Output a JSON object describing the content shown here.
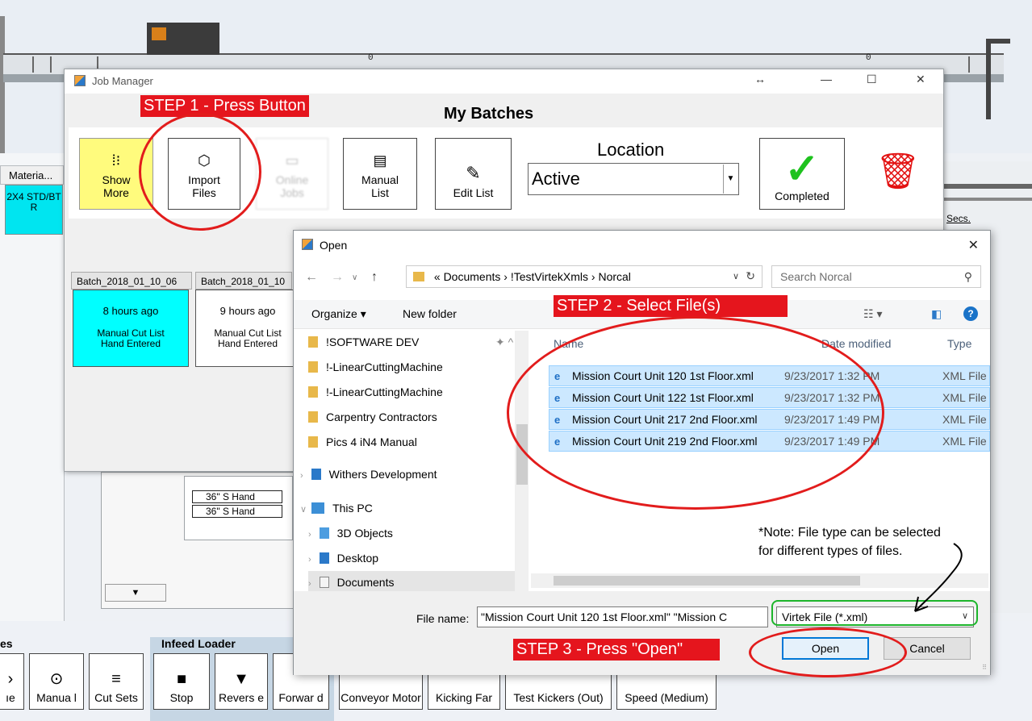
{
  "background": {
    "material_header": "Materia...",
    "material_cell": "2X4 STD/BT R",
    "secs_label": "Secs.",
    "hand_rows": [
      "36\"  S Hand",
      "36\"  S Hand"
    ],
    "scroll_glyph": "▼"
  },
  "bottom_toolbar": {
    "left_section_head": "es",
    "infeed_head": "Infeed Loader",
    "buttons": [
      {
        "glyph": "›",
        "label": "ıe"
      },
      {
        "glyph": "⊙",
        "label": "Manua l"
      },
      {
        "glyph": "≡",
        "label": "Cut Sets"
      },
      {
        "glyph": "■",
        "label": "Stop"
      },
      {
        "glyph": "▼",
        "label": "Revers e"
      },
      {
        "glyph": "",
        "label": "Forwar d"
      },
      {
        "glyph": "",
        "label": "Conveyor Motor"
      },
      {
        "glyph": "",
        "label": "Kicking Far"
      },
      {
        "glyph": "",
        "label": "Test Kickers (Out)"
      },
      {
        "glyph": "",
        "label": "Speed (Medium)"
      }
    ]
  },
  "job_manager": {
    "title": "Job Manager",
    "heading": "My Batches",
    "window_controls": [
      "↔",
      "—",
      "☐",
      "✕"
    ],
    "buttons": {
      "show_more": "Show More",
      "import_files": "Import Files",
      "online_jobs": "Online Jobs",
      "manual_list": "Manual List",
      "edit_list": "Edit List",
      "completed": "Completed"
    },
    "location_label": "Location",
    "location_value": "Active",
    "batches": [
      {
        "name": "Batch_2018_01_10_06",
        "ago": "8 hours ago",
        "desc1": "Manual Cut List",
        "desc2": "Hand Entered",
        "color": "#00ffff"
      },
      {
        "name": "Batch_2018_01_10",
        "ago": "9 hours ago",
        "desc1": "Manual Cut List",
        "desc2": "Hand Entered",
        "color": "#ffffff"
      }
    ]
  },
  "open_dialog": {
    "title": "Open",
    "address": "«  Documents  ›  !TestVirtekXmls  ›  Norcal",
    "search_placeholder": "Search Norcal",
    "organize": "Organize ▾",
    "new_folder": "New folder",
    "tree": [
      {
        "label": "!SOFTWARE DEV",
        "pinned": "📌"
      },
      {
        "label": "!-LinearCuttingMachine"
      },
      {
        "label": "!-LinearCuttingMachine"
      },
      {
        "label": "Carpentry Contractors"
      },
      {
        "label": "Pics 4 iN4 Manual"
      },
      {
        "label": "Withers Development"
      },
      {
        "label": "This PC"
      },
      {
        "label": "3D Objects"
      },
      {
        "label": "Desktop"
      },
      {
        "label": "Documents"
      }
    ],
    "columns": {
      "name": "Name",
      "date": "Date modified",
      "type": "Type"
    },
    "files": [
      {
        "name": "Mission Court Unit 120 1st Floor.xml",
        "date": "9/23/2017 1:32 PM",
        "type": "XML File"
      },
      {
        "name": "Mission Court Unit 122 1st Floor.xml",
        "date": "9/23/2017 1:32 PM",
        "type": "XML File"
      },
      {
        "name": "Mission Court Unit 217 2nd Floor.xml",
        "date": "9/23/2017 1:49 PM",
        "type": "XML File"
      },
      {
        "name": "Mission Court Unit 219 2nd Floor.xml",
        "date": "9/23/2017 1:49 PM",
        "type": "XML File"
      }
    ],
    "file_name_label": "File name:",
    "file_name_value": "\"Mission Court Unit 120 1st Floor.xml\" \"Mission C",
    "file_type_value": "Virtek File  (*.xml)",
    "open_button": "Open",
    "cancel_button": "Cancel"
  },
  "annotations": {
    "step1": "STEP 1 - Press Button",
    "step2": "STEP 2 - Select File(s)",
    "step3": "STEP 3 - Press \"Open\"",
    "note_line1": "*Note: File type can be selected",
    "note_line2": "for different types of files."
  },
  "colors": {
    "annotation_red": "#e5151d",
    "selection_blue": "#cce8ff",
    "show_more_yellow": "#fffb7d",
    "batch_cyan": "#00ffff",
    "trash_red": "#e31313",
    "check_green": "#1ec21e"
  }
}
